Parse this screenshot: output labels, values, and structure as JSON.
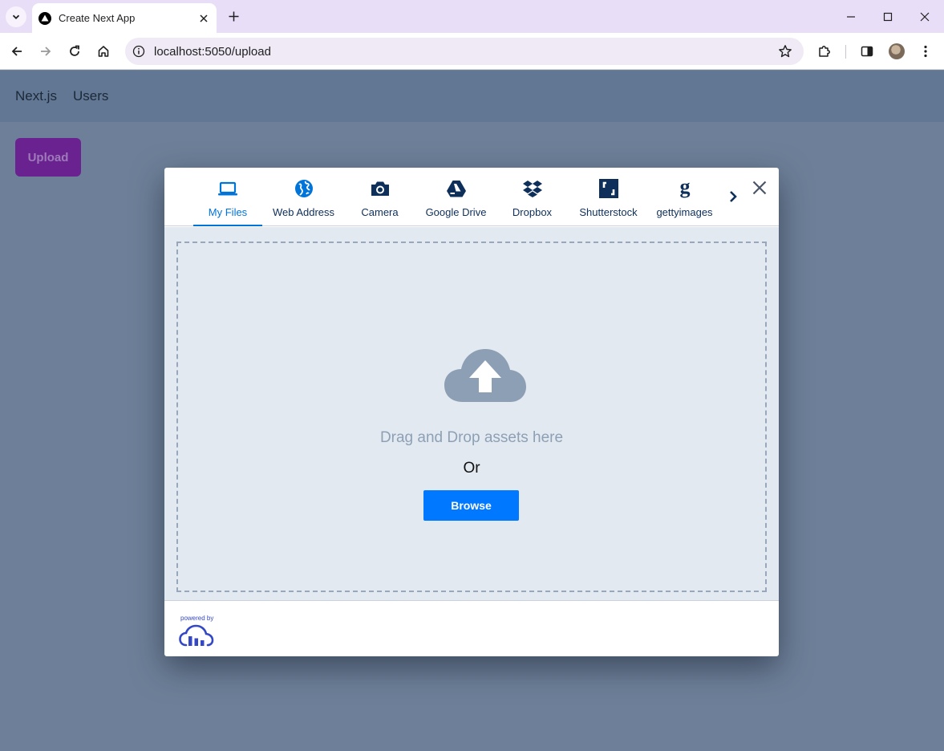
{
  "browser": {
    "tab_title": "Create Next App",
    "url": "localhost:5050/upload"
  },
  "app": {
    "nav_links": [
      "Next.js",
      "Users"
    ],
    "upload_label": "Upload"
  },
  "widget": {
    "sources": [
      {
        "label": "My Files",
        "icon": "laptop-icon",
        "active": true
      },
      {
        "label": "Web Address",
        "icon": "globe-icon",
        "active": false
      },
      {
        "label": "Camera",
        "icon": "camera-icon",
        "active": false
      },
      {
        "label": "Google Drive",
        "icon": "google-drive-icon",
        "active": false
      },
      {
        "label": "Dropbox",
        "icon": "dropbox-icon",
        "active": false
      },
      {
        "label": "Shutterstock",
        "icon": "shutterstock-icon",
        "active": false
      },
      {
        "label": "gettyimages",
        "icon": "gettyimages-icon",
        "active": false
      }
    ],
    "drop_text": "Drag and Drop assets here",
    "or_text": "Or",
    "browse_label": "Browse",
    "powered_by": "powered by"
  },
  "colors": {
    "accent": "#0078ff",
    "active_tab": "#0074d9",
    "upload_button": "#6b2291",
    "page_background": "#6e8099"
  }
}
